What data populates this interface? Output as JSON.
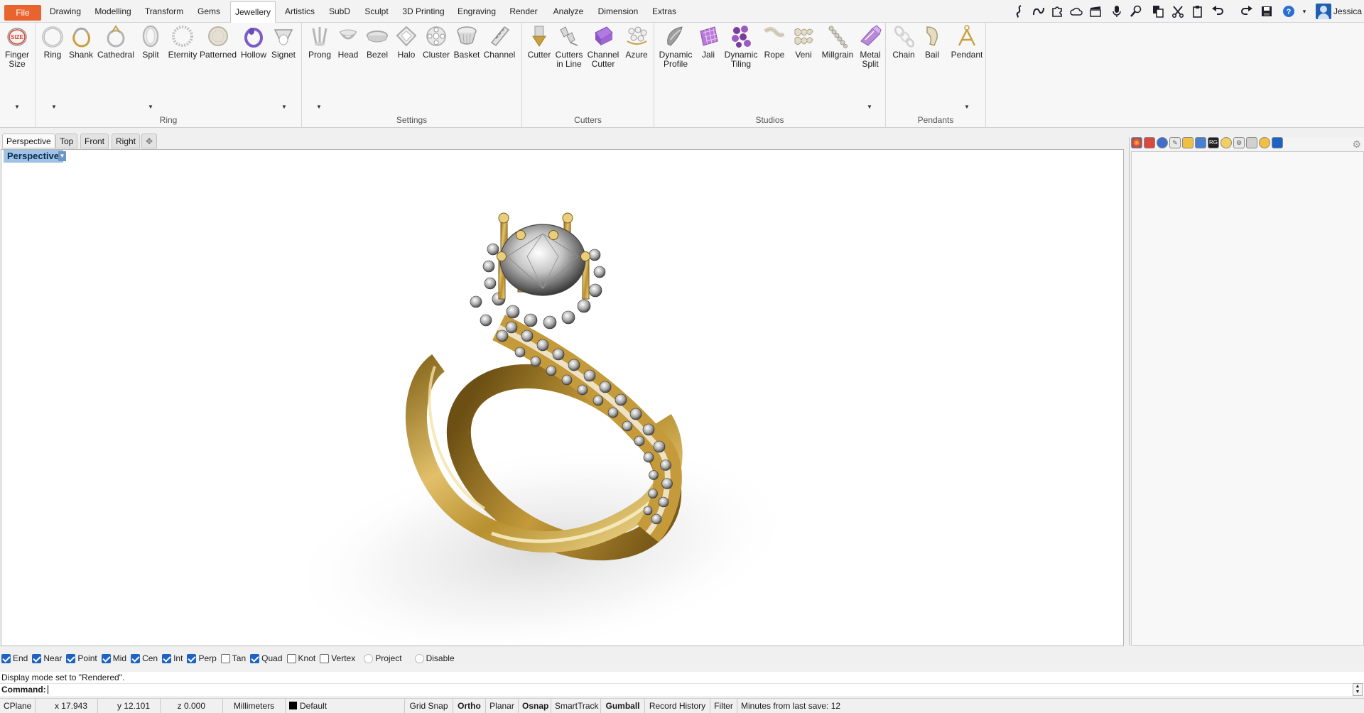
{
  "menu": {
    "tabs": [
      "File",
      "Drawing",
      "Modelling",
      "Transform",
      "Gems",
      "Jewellery",
      "Artistics",
      "SubD",
      "Sculpt",
      "3D Printing",
      "Engraving",
      "Render",
      "Analyze",
      "Dimension",
      "Extras"
    ],
    "active": "Jewellery"
  },
  "quick_icons": [
    "grasshopper-icon",
    "curve-icon",
    "puzzle-icon",
    "cloud-icon",
    "clapper-icon",
    "microphone-icon",
    "zoom-icon",
    "copy-icon",
    "cut-icon",
    "paste-icon",
    "undo-icon",
    "redo-icon",
    "save-icon",
    "help-icon"
  ],
  "user": {
    "name": "Jessica"
  },
  "ribbon": {
    "groups": [
      {
        "label": "",
        "buttons": [
          "Finger\nSize"
        ]
      },
      {
        "label": "Ring",
        "buttons": [
          "Ring",
          "Shank",
          "Cathedral",
          "Split",
          "Eternity",
          "Patterned",
          "Hollow",
          "Signet"
        ]
      },
      {
        "label": "Settings",
        "buttons": [
          "Prong",
          "Head",
          "Bezel",
          "Halo",
          "Cluster",
          "Basket",
          "Channel"
        ]
      },
      {
        "label": "Cutters",
        "buttons": [
          "Cutter",
          "Cutters\nin Line",
          "Channel\nCutter",
          "Azure"
        ]
      },
      {
        "label": "Studios",
        "buttons": [
          "Dynamic\nProfile",
          "Jali",
          "Dynamic\nTiling",
          "Rope",
          "Veni",
          "Millgrain",
          "Metal\nSplit"
        ]
      },
      {
        "label": "Pendants",
        "buttons": [
          "Chain",
          "Bail",
          "Pendant"
        ]
      }
    ]
  },
  "viewport_tabs": [
    "Perspective",
    "Top",
    "Front",
    "Right"
  ],
  "viewport": {
    "label": "Perspective"
  },
  "osnaps": [
    {
      "label": "End",
      "checked": true
    },
    {
      "label": "Near",
      "checked": true
    },
    {
      "label": "Point",
      "checked": true
    },
    {
      "label": "Mid",
      "checked": true
    },
    {
      "label": "Cen",
      "checked": true
    },
    {
      "label": "Int",
      "checked": true
    },
    {
      "label": "Perp",
      "checked": true
    },
    {
      "label": "Tan",
      "checked": false
    },
    {
      "label": "Quad",
      "checked": true
    },
    {
      "label": "Knot",
      "checked": false
    },
    {
      "label": "Vertex",
      "checked": false
    },
    {
      "label": "Project",
      "checked": false
    },
    {
      "label": "Disable",
      "checked": false
    }
  ],
  "command": {
    "history": "Display mode set to \"Rendered\".",
    "prompt": "Command:"
  },
  "status": {
    "cplane": "CPlane",
    "x": "x 17.943",
    "y": "y 12.101",
    "z": "z 0.000",
    "units": "Millimeters",
    "layer": "Default",
    "grid_snap": "Grid Snap",
    "ortho": "Ortho",
    "planar": "Planar",
    "osnap": "Osnap",
    "smarttrack": "SmartTrack",
    "gumball": "Gumball",
    "record_history": "Record History",
    "filter": "Filter",
    "save_info": "Minutes from last save: 12"
  },
  "colors": {
    "file_tab": "#e8632e",
    "viewport_label_bg": "#9ec3e6",
    "checkbox": "#1e63c4",
    "gold": "#c9a040"
  }
}
